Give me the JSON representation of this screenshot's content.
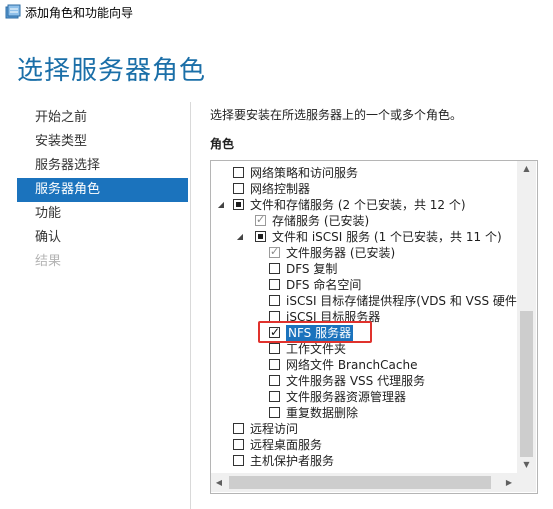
{
  "window": {
    "title": "添加角色和功能向导"
  },
  "page_heading": "选择服务器角色",
  "nav": {
    "items": [
      {
        "label": "开始之前",
        "state": "normal"
      },
      {
        "label": "安装类型",
        "state": "normal"
      },
      {
        "label": "服务器选择",
        "state": "normal"
      },
      {
        "label": "服务器角色",
        "state": "active"
      },
      {
        "label": "功能",
        "state": "normal"
      },
      {
        "label": "确认",
        "state": "normal"
      },
      {
        "label": "结果",
        "state": "disabled"
      }
    ]
  },
  "main": {
    "instructions": "选择要安装在所选服务器上的一个或多个角色。",
    "roles_label": "角色",
    "tree": [
      {
        "label": "网络策略和访问服务",
        "level": 0,
        "check": "unchecked",
        "expander": ""
      },
      {
        "label": "网络控制器",
        "level": 0,
        "check": "unchecked",
        "expander": ""
      },
      {
        "label": "文件和存储服务 (2 个已安装，共 12 个)",
        "level": 0,
        "check": "partial",
        "expander": "expanded"
      },
      {
        "label": "存储服务 (已安装)",
        "level": 1,
        "check": "checked-disabled",
        "expander": ""
      },
      {
        "label": "文件和 iSCSI 服务 (1 个已安装，共 11 个)",
        "level": 1,
        "check": "partial",
        "expander": "expanded"
      },
      {
        "label": "文件服务器 (已安装)",
        "level": 2,
        "check": "checked-disabled",
        "expander": ""
      },
      {
        "label": "DFS 复制",
        "level": 2,
        "check": "unchecked",
        "expander": ""
      },
      {
        "label": "DFS 命名空间",
        "level": 2,
        "check": "unchecked",
        "expander": ""
      },
      {
        "label": "iSCSI 目标存储提供程序(VDS 和 VSS 硬件",
        "level": 2,
        "check": "unchecked",
        "expander": ""
      },
      {
        "label": "iSCSI 目标服务器",
        "level": 2,
        "check": "unchecked",
        "expander": ""
      },
      {
        "label": "NFS 服务器",
        "level": 2,
        "check": "checked",
        "expander": "",
        "selected": true
      },
      {
        "label": "工作文件夹",
        "level": 2,
        "check": "unchecked",
        "expander": ""
      },
      {
        "label": "网络文件 BranchCache",
        "level": 2,
        "check": "unchecked",
        "expander": ""
      },
      {
        "label": "文件服务器 VSS 代理服务",
        "level": 2,
        "check": "unchecked",
        "expander": ""
      },
      {
        "label": "文件服务器资源管理器",
        "level": 2,
        "check": "unchecked",
        "expander": ""
      },
      {
        "label": "重复数据删除",
        "level": 2,
        "check": "unchecked",
        "expander": ""
      },
      {
        "label": "远程访问",
        "level": 0,
        "check": "unchecked",
        "expander": ""
      },
      {
        "label": "远程桌面服务",
        "level": 0,
        "check": "unchecked",
        "expander": ""
      },
      {
        "label": "主机保护者服务",
        "level": 0,
        "check": "unchecked",
        "expander": ""
      }
    ],
    "vertical_scroll_fraction": 0.5
  },
  "colors": {
    "heading": "#1b6fa8",
    "nav_active_bg": "#1b73bd",
    "selection_bg": "#1b73bd",
    "annotation_border": "#e0322d"
  },
  "icons": {
    "app": "wizard-app-icon",
    "expanded": "triangle-down-icon",
    "scroll_up": "scroll-up-arrow-icon",
    "scroll_down": "scroll-down-arrow-icon",
    "scroll_left": "scroll-left-arrow-icon",
    "scroll_right": "scroll-right-arrow-icon"
  }
}
